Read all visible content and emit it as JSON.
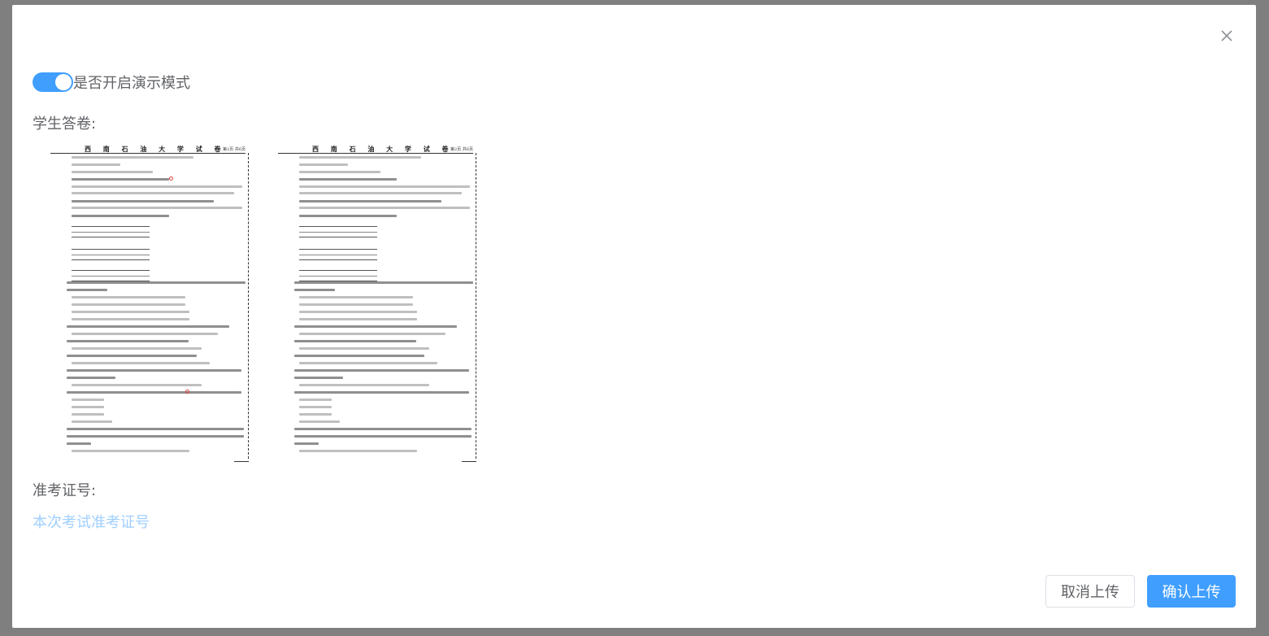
{
  "dialog": {
    "close_icon": "close-icon",
    "demo_switch": {
      "label": "是否开启演示模式",
      "on": true,
      "accent": "#409eff"
    },
    "answers_label": "学生答卷:",
    "answer_sheets": [
      {
        "paper_title": "西 南 石 油 大 学 试 卷",
        "page": "第2页 共6页"
      },
      {
        "paper_title": "西 南 石 油 大 学 试 卷",
        "page": "第2页 共6页"
      }
    ],
    "exam_number_label": "准考证号:",
    "exam_number_placeholder": "本次考试准考证号",
    "buttons": {
      "cancel": "取消上传",
      "confirm": "确认上传"
    }
  }
}
